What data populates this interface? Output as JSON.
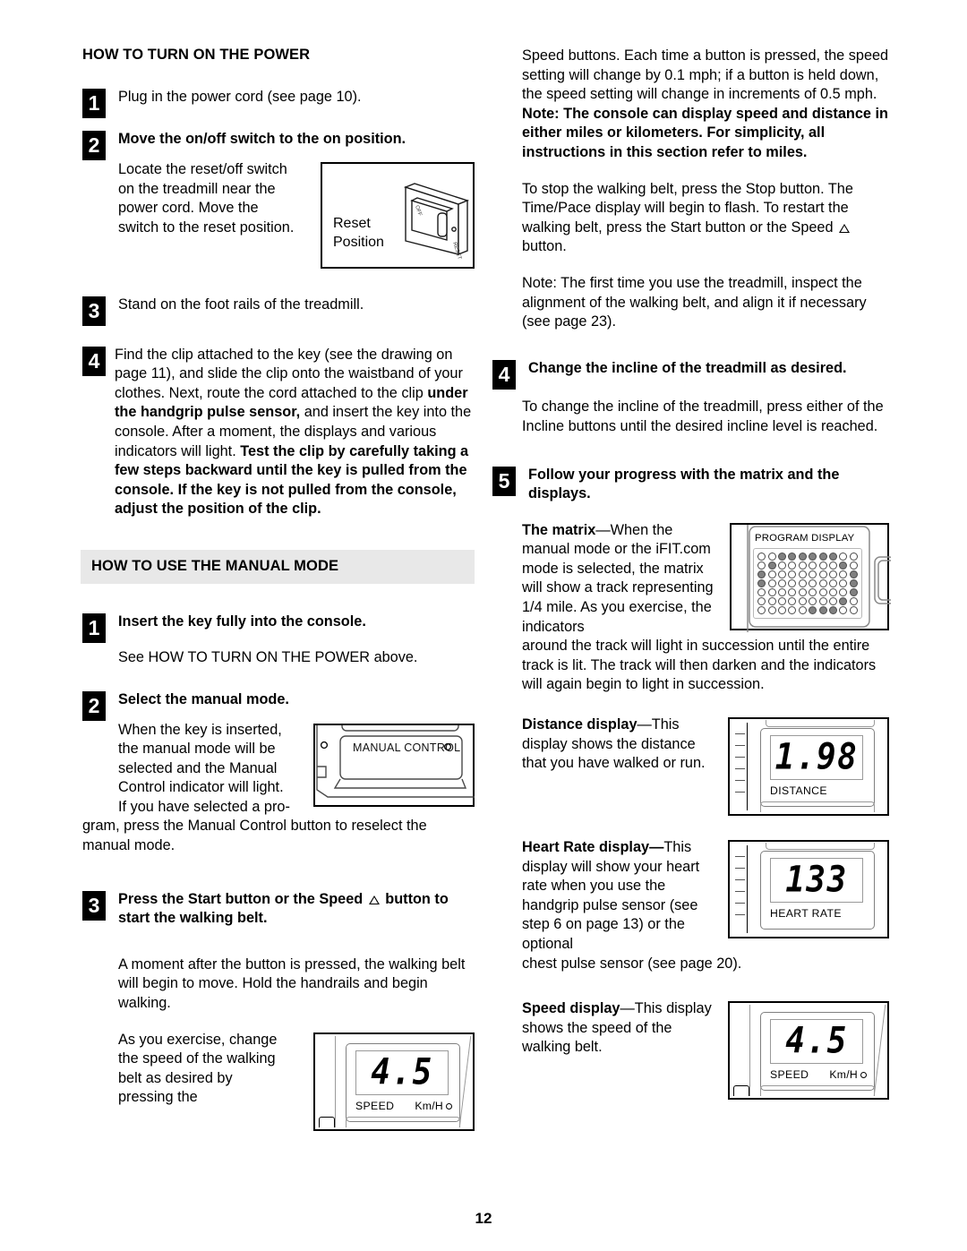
{
  "page_number": "12",
  "left_column": {
    "section1": {
      "heading": "HOW TO TURN ON THE POWER",
      "steps": [
        {
          "num": "1",
          "heading": "Plug in the power cord (see page 10).",
          "bold": false
        },
        {
          "num": "2",
          "heading": "Move the on/off switch to the on position.",
          "bold": true,
          "body": "Locate the reset/off switch on the treadmill near the power cord. Move the switch to the reset position."
        },
        {
          "num": "3",
          "heading": "Stand on the foot rails of the treadmill.",
          "bold": false
        },
        {
          "num": "4",
          "heading": "",
          "bold": false
        }
      ],
      "reset_figure": {
        "label_line1": "Reset",
        "label_line2": "Position"
      },
      "step4_part1": "Find the clip attached to the key (see the drawing on page 11), and slide the clip onto the waistband of your clothes. Next, route the cord attached to the clip ",
      "step4_bold1": "under the handgrip pulse sensor,",
      "step4_part2": " and insert the key into the console. After a moment, the displays and various indicators will light. ",
      "step4_bold2": "Test the clip by carefully taking a few steps backward until the key is pulled from the console. If the key is not pulled from the console, adjust the position of the clip."
    },
    "section2": {
      "heading": "HOW TO USE THE MANUAL MODE",
      "step1": {
        "num": "1",
        "heading": "Insert the key fully into the console.",
        "body": "See HOW TO TURN ON THE POWER above."
      },
      "step2": {
        "num": "2",
        "heading": "Select the manual mode.",
        "body_wrap": "When the key is inserted, the manual mode will be selected and the Manual Control indicator will light. If you have selected a pro-",
        "body_full": "gram, press the Manual Control button to reselect the manual mode."
      },
      "manual_figure": {
        "label": "MANUAL CONTROL"
      },
      "step3": {
        "num": "3",
        "heading_part1": "Press the Start button or the Speed ",
        "heading_part2": " button to start the walking belt.",
        "body1": "A moment after the button is pressed, the walking belt will begin to move. Hold the handrails and begin walking.",
        "body2": "As you exercise, change the speed of the walking belt as desired by pressing the"
      },
      "speed_figure": {
        "value": "4.5",
        "caption": "SPEED",
        "unit": "Km/H"
      }
    }
  },
  "right_column": {
    "para1_plain": "Speed buttons. Each time a button is pressed, the speed setting will change by 0.1 mph; if a button is held down, the speed setting will change in increments of 0.5 mph. ",
    "para1_bold": "Note: The console can display speed and distance in either miles or kilometers. For simplicity, all instructions in this section refer to miles.",
    "para2_a": "To stop the walking belt, press the Stop button. The Time/Pace display will begin to flash. To restart the walking belt, press the Start button or the Speed ",
    "para2_b": " button.",
    "para3": "Note: The first time you use the treadmill, inspect the alignment of the walking belt, and align it if necessary (see page 23).",
    "step4": {
      "num": "4",
      "heading": "Change the incline of the treadmill as desired.",
      "body": "To change the incline of the treadmill, press either of the Incline buttons until the desired incline level is reached."
    },
    "step5": {
      "num": "5",
      "heading": "Follow your progress with the matrix and the displays.",
      "matrix_bold": "The matrix",
      "matrix_text": "—When the manual mode or the iFIT.com mode is selected, the matrix will show a track representing 1/4 mile. As you exercise, the indicators",
      "matrix_cont": "around the track will light in succession until the entire track is lit. The track will then darken and the indicators will again begin to light in succession.",
      "distance_bold": "Distance display",
      "distance_text": "—This display shows the distance that you have walked or run.",
      "heart_bold": "Heart Rate display",
      "heart_text": "—",
      "heart_text2": "This display will show your heart rate when you use the handgrip pulse sensor (see step 6 on page 13) or the optional",
      "heart_cont": "chest pulse sensor (see page 20).",
      "speed_bold": "Speed display",
      "speed_text": "—This display shows the speed of the walking belt."
    },
    "program_figure": {
      "label": "PROGRAM DISPLAY",
      "matrix_rows": 7,
      "matrix_cols": 10,
      "lit": [
        [
          0,
          0,
          1,
          1,
          1,
          1,
          1,
          1,
          0,
          0
        ],
        [
          0,
          1,
          0,
          0,
          0,
          0,
          0,
          0,
          1,
          0
        ],
        [
          1,
          0,
          0,
          0,
          0,
          0,
          0,
          0,
          0,
          1
        ],
        [
          1,
          0,
          0,
          0,
          0,
          0,
          0,
          0,
          0,
          1
        ],
        [
          0,
          0,
          0,
          0,
          0,
          0,
          0,
          0,
          0,
          1
        ],
        [
          0,
          0,
          0,
          0,
          0,
          0,
          0,
          0,
          1,
          0
        ],
        [
          0,
          0,
          0,
          0,
          0,
          1,
          1,
          1,
          0,
          0
        ]
      ]
    },
    "distance_figure": {
      "value": "1.98",
      "caption": "DISTANCE"
    },
    "heart_figure": {
      "value": "133",
      "caption": "HEART RATE"
    },
    "speed_figure": {
      "value": "4.5",
      "caption": "SPEED",
      "unit": "Km/H"
    }
  }
}
